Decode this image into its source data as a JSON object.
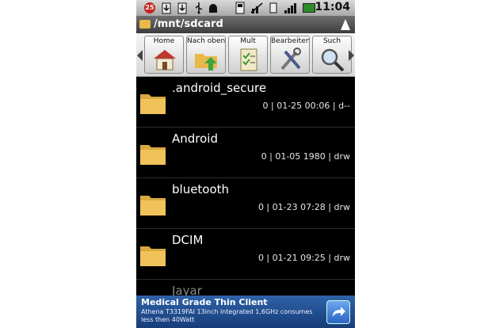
{
  "status_bar": {
    "badge_count": "25",
    "time": "11:04"
  },
  "path_bar": {
    "path": "/mnt/sdcard"
  },
  "toolbar": {
    "buttons": [
      {
        "label": "Home"
      },
      {
        "label": "Nach oben"
      },
      {
        "label": "Mult"
      },
      {
        "label": "Bearbeiten"
      },
      {
        "label": "Such"
      }
    ]
  },
  "files": [
    {
      "name": ".android_secure",
      "meta": "0 | 01-25 00:06 | d--"
    },
    {
      "name": "Android",
      "meta": "0 | 01-05 1980 | drw"
    },
    {
      "name": "bluetooth",
      "meta": "0 | 01-23 07:28 | drw"
    },
    {
      "name": "DCIM",
      "meta": "0 | 01-21 09:25 | drw"
    },
    {
      "name": "Jayar",
      "meta": ""
    }
  ],
  "ad": {
    "title": "Medical Grade Thin Client",
    "body": "Athena T3319FAI 13inch integrated 1,6GHz consumes less then 40Watt"
  },
  "colors": {
    "folder": "#e8b94a",
    "ad_background": "#1f4f93",
    "badge": "#c4241c"
  }
}
